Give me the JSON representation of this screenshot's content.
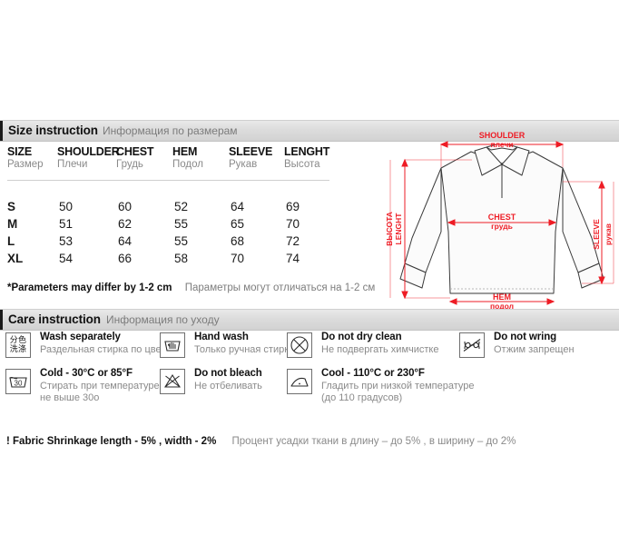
{
  "sections": {
    "size": {
      "title_en": "Size instruction",
      "title_ru": "Информация по размерам"
    },
    "care": {
      "title_en": "Care instruction",
      "title_ru": "Информация по уходу"
    }
  },
  "size_table": {
    "columns": [
      {
        "en": "SIZE",
        "ru": "Размер"
      },
      {
        "en": "SHOULDER",
        "ru": "Плечи"
      },
      {
        "en": "CHEST",
        "ru": "Грудь"
      },
      {
        "en": "HEM",
        "ru": "Подол"
      },
      {
        "en": "SLEEVE",
        "ru": "Рукав"
      },
      {
        "en": "LENGHT",
        "ru": "Высота"
      }
    ],
    "rows": [
      {
        "size": "S",
        "shoulder": "50",
        "chest": "60",
        "hem": "52",
        "sleeve": "64",
        "lenght": "69"
      },
      {
        "size": "M",
        "shoulder": "51",
        "chest": "62",
        "hem": "55",
        "sleeve": "65",
        "lenght": "70"
      },
      {
        "size": "L",
        "shoulder": "53",
        "chest": "64",
        "hem": "55",
        "sleeve": "68",
        "lenght": "72"
      },
      {
        "size": "XL",
        "shoulder": "54",
        "chest": "66",
        "hem": "58",
        "sleeve": "70",
        "lenght": "74"
      }
    ],
    "note_en": "*Parameters may differ by 1-2 cm",
    "note_ru": "Параметры могут отличаться на 1-2 см"
  },
  "diagram": {
    "labels": {
      "shoulder_en": "SHOULDER",
      "shoulder_ru": "плечи",
      "chest_en": "CHEST",
      "chest_ru": "грудь",
      "hem_en": "HEM",
      "hem_ru": "подол",
      "sleeve_en": "SLEEVE",
      "sleeve_ru": "рукав",
      "lenght_en": "LENGHT",
      "lenght_ru": "ВЫСОТА"
    },
    "accent_color": "#ee1c25",
    "outline_color": "#3a3a3a",
    "fill_color": "#fbfbfb"
  },
  "care_items": [
    {
      "icon": "separate-colors-icon",
      "icon_text_top": "分色",
      "icon_text_bottom": "洗涤",
      "en": "Wash separately",
      "ru": [
        "Раздельная стирка по цветам"
      ]
    },
    {
      "icon": "hand-wash-icon",
      "en": "Hand wash",
      "ru": [
        "Только ручная стирка"
      ]
    },
    {
      "icon": "do-not-dry-clean-icon",
      "en": "Do not dry clean",
      "ru": [
        "Не подвергать химчистке"
      ]
    },
    {
      "icon": "do-not-wring-icon",
      "en": "Do not wring",
      "ru": [
        "Отжим запрещен"
      ]
    },
    {
      "icon": "wash-30-icon",
      "icon_label": "30",
      "en": "Cold - 30°C or 85°F",
      "ru": [
        "Стирать при температуре",
        "не выше 30о"
      ]
    },
    {
      "icon": "do-not-bleach-icon",
      "en": "Do not bleach",
      "ru": [
        "Не отбеливать"
      ]
    },
    {
      "icon": "iron-low-icon",
      "en": "Cool - 110°C or 230°F",
      "ru": [
        "Гладить при низкой температуре",
        "(до 110 градусов)"
      ]
    }
  ],
  "shrinkage": {
    "en": "!  Fabric Shrinkage length - 5% , width - 2%",
    "ru": "Процент усадки ткани в длину – до 5% , в ширину – до 2%"
  }
}
